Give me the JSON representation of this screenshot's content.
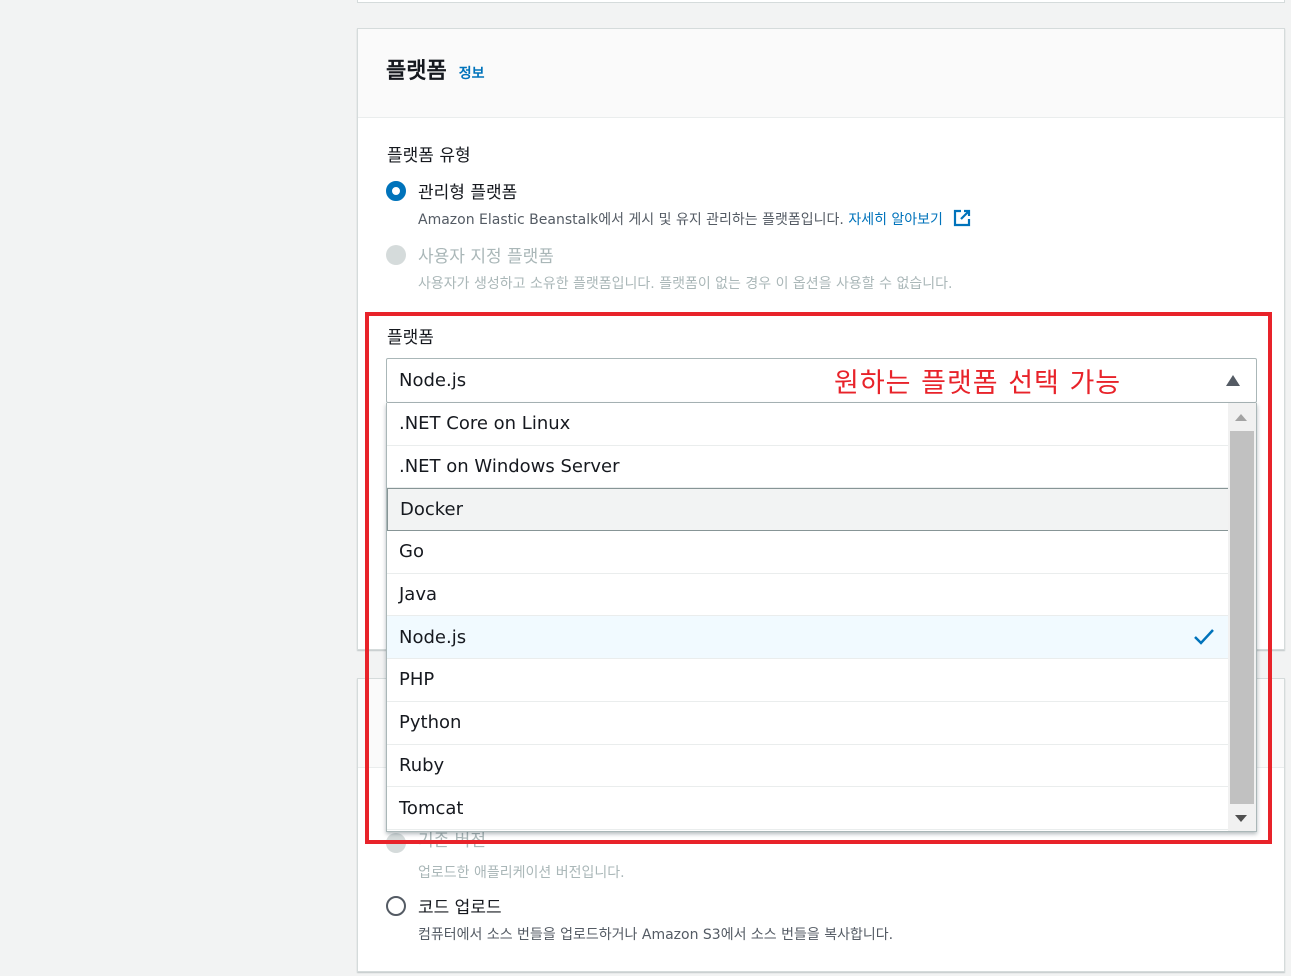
{
  "platform_section": {
    "title": "플랫폼",
    "info_link": "정보",
    "platform_type_label": "플랫폼 유형",
    "managed": {
      "label": "관리형 플랫폼",
      "desc": "Amazon Elastic Beanstalk에서 게시 및 유지 관리하는 플랫폼입니다.",
      "learn_more": "자세히 알아보기"
    },
    "custom": {
      "label": "사용자 지정 플랫폼",
      "desc": "사용자가 생성하고 소유한 플랫폼입니다. 플랫폼이 없는 경우 이 옵션을 사용할 수 없습니다."
    },
    "platform_label": "플랫폼",
    "selected_value": "Node.js",
    "options": [
      ".NET Core on Linux",
      ".NET on Windows Server",
      "Docker",
      "Go",
      "Java",
      "Node.js",
      "PHP",
      "Python",
      "Ruby",
      "Tomcat"
    ],
    "hovered_option": "Docker"
  },
  "annotation": "원하는 플랫폼 선택 가능",
  "code_section": {
    "existing_version_label": "기존 버전",
    "existing_version_desc": "업로드한 애플리케이션 버전입니다.",
    "upload_label": "코드 업로드",
    "upload_desc": "컴퓨터에서 소스 번들을 업로드하거나 Amazon S3에서 소스 번들을 복사합니다."
  },
  "colors": {
    "accent": "#0073bb",
    "annotation_red": "#e8232a"
  }
}
